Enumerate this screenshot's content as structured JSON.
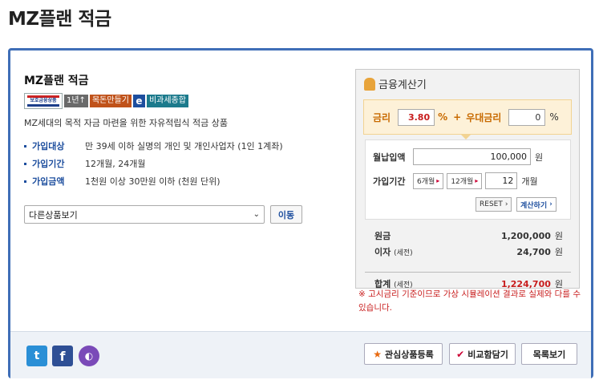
{
  "page": {
    "title": "MZ플랜 적금"
  },
  "product": {
    "name": "MZ플랜 적금",
    "badges": {
      "protect_top": "예금보호",
      "protect_mid": "보호금융상품",
      "period": "1년↑",
      "type": "목돈만들기",
      "online": "e",
      "tax": "비과세종합"
    },
    "description": "MZ세대의 목적 자금 마련을 위한 자유적립식 적금 상품",
    "info": [
      {
        "label": "가입대상",
        "value": "만 39세 이하 실명의 개인 및 개인사업자 (1인 1계좌)"
      },
      {
        "label": "가입기간",
        "value": "12개월, 24개월"
      },
      {
        "label": "가입금액",
        "value": "1천원 이상 30만원 이하 (천원 단위)"
      }
    ],
    "select": {
      "value": "다른상품보기"
    },
    "go_label": "이동"
  },
  "calculator": {
    "title": "금융계산기",
    "rate_label": "금리",
    "rate_value": "3.80",
    "percent": "%",
    "plus": "+",
    "bonus_label": "우대금리",
    "bonus_value": "0",
    "monthly_label": "월납입액",
    "monthly_value": "100,000",
    "won": "원",
    "period_label": "가입기간",
    "btn_6m": "6개월",
    "btn_12m": "12개월",
    "months_value": "12",
    "months_unit": "개월",
    "reset_label": "RESET",
    "calc_label": "계산하기",
    "results": {
      "principal_label": "원금",
      "principal_value": "1,200,000",
      "interest_label": "이자",
      "interest_note": "(세전)",
      "interest_value": "24,700",
      "total_label": "합계",
      "total_note": "(세전)",
      "total_value": "1,224,700"
    },
    "note": "※ 고시금리 기준이므로 가상 시뮬레이션 결과로 실제와 다를 수 있습니다."
  },
  "footer": {
    "favorite_label": "관심상품등록",
    "compare_label": "비교함담기",
    "list_label": "목록보기"
  },
  "colors": {
    "accent": "#3f6eb7",
    "highlight": "#c81d1d",
    "rate_bg": "#fdf1d8"
  }
}
